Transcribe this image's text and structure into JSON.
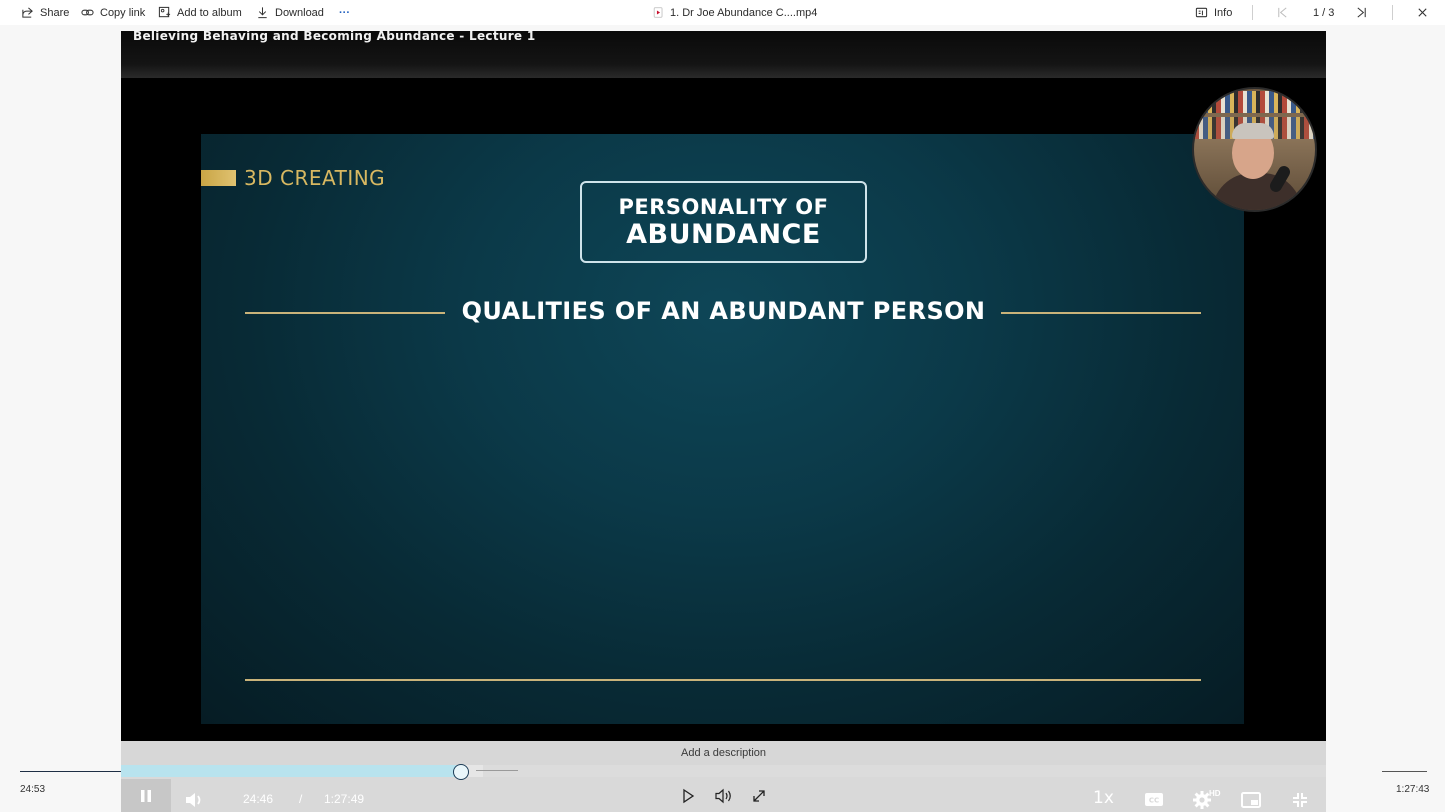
{
  "toolbar": {
    "share": "Share",
    "copy_link": "Copy link",
    "add_to_album": "Add to album",
    "download": "Download",
    "more": "···",
    "file_name": "1. Dr Joe Abundance C....mp4",
    "info": "Info",
    "position": "1 / 3"
  },
  "video": {
    "title_overlay": "Believing Behaving and Becoming Abundance - Lecture 1",
    "slide": {
      "brand": "3D CREATING",
      "box_line1": "PERSONALITY OF",
      "box_line2": "ABUNDANCE",
      "heading": "QUALITIES OF AN ABUNDANT PERSON"
    }
  },
  "description": {
    "placeholder": "Add a description"
  },
  "outer_seek": {
    "elapsed": "24:53",
    "duration": "1:27:43"
  },
  "player": {
    "current_time": "24:46",
    "separator": "/",
    "duration": "1:27:49",
    "progress_fraction": 0.2825,
    "buffered_fraction": 0.3,
    "speed": "1x",
    "quality_badge": "HD"
  },
  "colors": {
    "played": "#b8e3ee",
    "knob_border": "#1d3d57",
    "slide_gold": "#d8b861"
  },
  "icons": [
    "share-icon",
    "link-icon",
    "album-icon",
    "download-icon",
    "file-video-icon",
    "info-icon",
    "first-icon",
    "last-icon",
    "close-icon",
    "pause-icon",
    "volume-icon",
    "play-icon",
    "audio-icon",
    "expand-icon",
    "captions-icon",
    "gear-icon",
    "pip-icon",
    "collapse-icon"
  ]
}
